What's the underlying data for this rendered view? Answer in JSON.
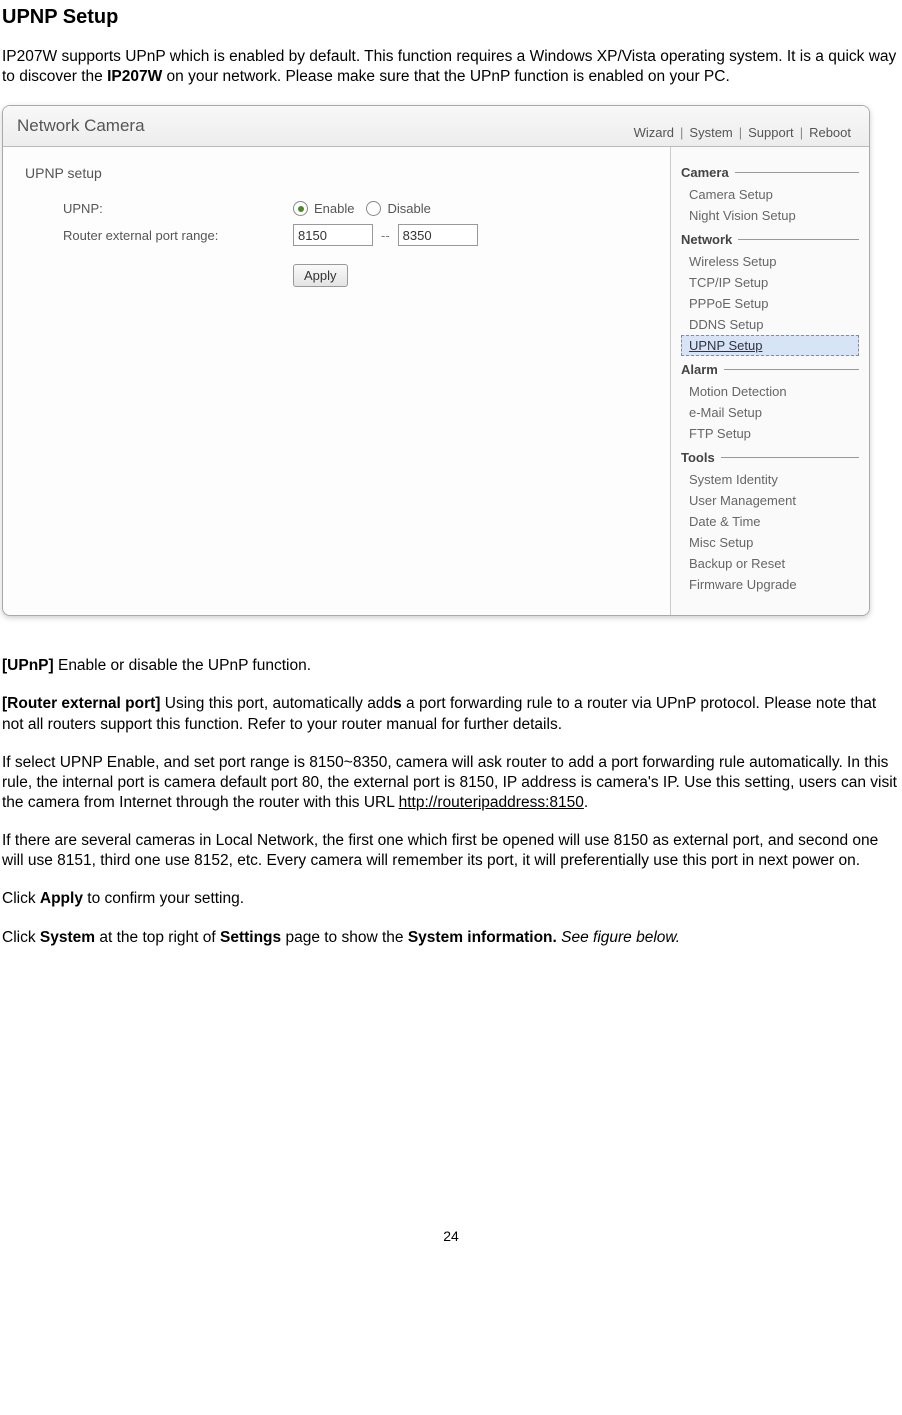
{
  "heading": "UPNP Setup",
  "intro": {
    "pre": "IP207W supports UPnP which is enabled by default. This function requires a Windows XP/Vista operating system. It is a quick way to discover the ",
    "bold": "IP207W",
    "post": " on your network. Please make sure that the UPnP function is enabled on your PC."
  },
  "ui": {
    "title": "Network Camera",
    "toplinks": [
      "Wizard",
      "System",
      "Support",
      "Reboot"
    ],
    "main": {
      "section_title": "UPNP setup",
      "upnp_label": "UPNP:",
      "enable_label": "Enable",
      "disable_label": "Disable",
      "port_label": "Router external port range:",
      "port_start": "8150",
      "port_end": "8350",
      "apply": "Apply"
    },
    "sidebar": {
      "groups": [
        {
          "title": "Camera",
          "items": [
            "Camera Setup",
            "Night Vision Setup"
          ]
        },
        {
          "title": "Network",
          "items": [
            "Wireless Setup",
            "TCP/IP Setup",
            "PPPoE Setup",
            "DDNS Setup",
            "UPNP Setup"
          ]
        },
        {
          "title": "Alarm",
          "items": [
            "Motion Detection",
            "e-Mail Setup",
            "FTP Setup"
          ]
        },
        {
          "title": "Tools",
          "items": [
            "System Identity",
            "User Management",
            "Date & Time",
            "Misc Setup",
            "Backup or Reset",
            "Firmware Upgrade"
          ]
        }
      ],
      "selected": "UPNP Setup"
    }
  },
  "body": {
    "upnp_label": "[UPnP]",
    "upnp_text": " Enable or disable the UPnP function.",
    "router_label": "[Router external port]",
    "router_text_pre": " Using this port, automatically add",
    "router_text_bold": "s",
    "router_text_post": " a port forwarding rule to a router via UPnP protocol. Please note that not all routers support this function. Refer to your router manual for further details.",
    "para3_pre": "If select UPNP Enable, and set port range is 8150~8350, camera will ask router to add a port forwarding rule automatically. In this rule, the internal port is camera default port 80, the external port is 8150, IP address is camera's IP. Use this setting, users can visit the camera from Internet through the router with this URL ",
    "para3_url": "http://routeripaddress:8150",
    "para3_post": ".",
    "para4": "If there are several cameras in Local Network, the first one which first be opened will use 8150 as external port, and second one will use 8151, third one use 8152, etc. Every camera will remember its port, it will preferentially use this port in next power on.",
    "para5_pre": "Click ",
    "para5_bold": "Apply",
    "para5_post": " to confirm your setting.",
    "para6_pre": "Click ",
    "para6_b1": "System",
    "para6_mid1": " at the top right of ",
    "para6_b2": "Settings",
    "para6_mid2": " page to show the ",
    "para6_b3": "System information.",
    "para6_italic": " See figure below."
  },
  "page_number": "24"
}
